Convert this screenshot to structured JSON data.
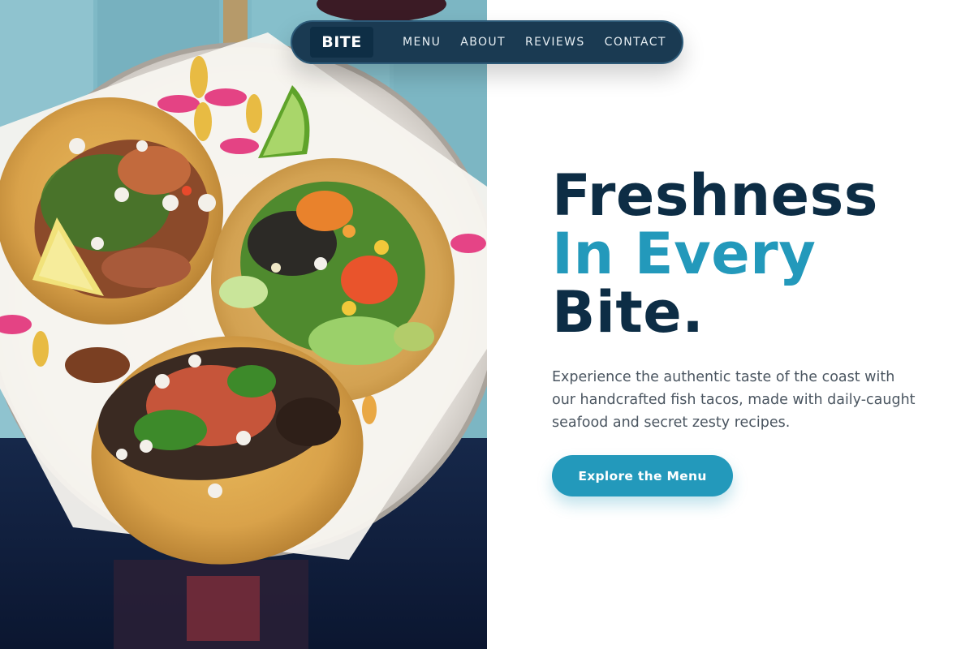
{
  "nav": {
    "logo": "BITE",
    "links": [
      "MENU",
      "ABOUT",
      "REVIEWS",
      "CONTACT"
    ]
  },
  "hero": {
    "headline_line1": "Freshness",
    "headline_line2": "In Every",
    "headline_line3": "Bite.",
    "description": "Experience the authentic taste of the coast with our handcrafted fish tacos, made with daily-caught seafood and secret zesty recipes.",
    "cta_label": "Explore the Menu"
  },
  "image": {
    "subject": "plate-of-tacos-photo"
  },
  "colors": {
    "navy": "#0d2d45",
    "accent": "#2399bb",
    "nav_bg": "#1a3a52",
    "text": "#4a5560"
  }
}
